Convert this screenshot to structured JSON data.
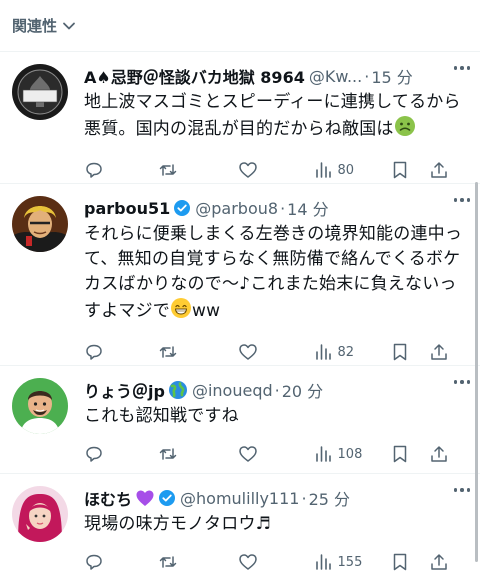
{
  "sort": {
    "label": "関連性"
  },
  "colors": {
    "secondary": "#536471",
    "verified": "#1d9bf0",
    "border": "#eff3f4"
  },
  "tweets": [
    {
      "name": "A♠忌野＠怪談バカ地獄 8964",
      "handle": "@Kw...",
      "dot": "·",
      "time": "15 分",
      "text": "地上波マスゴミとスピーディーに連携してるから悪質。国内の混乱が目的だからね敵国は",
      "emoji": "nauseated-face",
      "views": "80",
      "verified": false
    },
    {
      "name": "parbou51",
      "handle": "@parbou8",
      "dot": "·",
      "time": "14 分",
      "text": "それらに便乗しまくる左巻きの境界知能の連中って、無知の自覚すらなく無防備で絡んでくるボケカスばかりなので〜♪これまた始末に負えないっすよマジで",
      "text_tail": "ww",
      "emoji": "grinning-face",
      "views": "82",
      "verified": true
    },
    {
      "name": "りょう＠jp",
      "handle": "@inoueqd",
      "dot": "·",
      "time": "20 分",
      "text": "これも認知戦ですね",
      "emoji": "globe-icon",
      "views": "108",
      "verified": false
    },
    {
      "name": "ほむち",
      "handle": "@homulilly111",
      "dot": "·",
      "time": "25 分",
      "text": "現場の味方モノタロウ♬",
      "emoji": "purple-heart",
      "views": "155",
      "verified": true
    }
  ]
}
